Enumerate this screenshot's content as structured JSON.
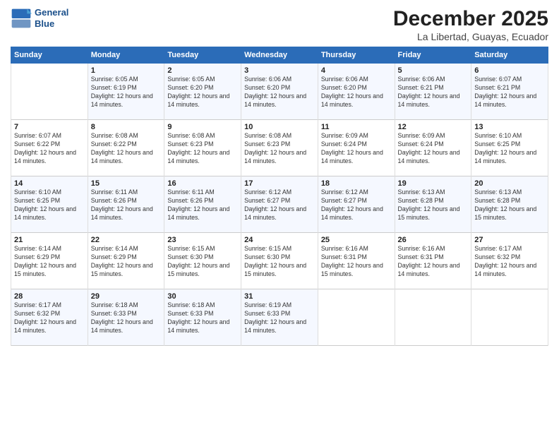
{
  "logo": {
    "line1": "General",
    "line2": "Blue"
  },
  "header": {
    "month": "December 2025",
    "location": "La Libertad, Guayas, Ecuador"
  },
  "days_of_week": [
    "Sunday",
    "Monday",
    "Tuesday",
    "Wednesday",
    "Thursday",
    "Friday",
    "Saturday"
  ],
  "weeks": [
    [
      {
        "day": "",
        "content": ""
      },
      {
        "day": "1",
        "content": "Sunrise: 6:05 AM\nSunset: 6:19 PM\nDaylight: 12 hours and 14 minutes."
      },
      {
        "day": "2",
        "content": "Sunrise: 6:05 AM\nSunset: 6:20 PM\nDaylight: 12 hours and 14 minutes."
      },
      {
        "day": "3",
        "content": "Sunrise: 6:06 AM\nSunset: 6:20 PM\nDaylight: 12 hours and 14 minutes."
      },
      {
        "day": "4",
        "content": "Sunrise: 6:06 AM\nSunset: 6:20 PM\nDaylight: 12 hours and 14 minutes."
      },
      {
        "day": "5",
        "content": "Sunrise: 6:06 AM\nSunset: 6:21 PM\nDaylight: 12 hours and 14 minutes."
      },
      {
        "day": "6",
        "content": "Sunrise: 6:07 AM\nSunset: 6:21 PM\nDaylight: 12 hours and 14 minutes."
      }
    ],
    [
      {
        "day": "7",
        "content": "Sunrise: 6:07 AM\nSunset: 6:22 PM\nDaylight: 12 hours and 14 minutes."
      },
      {
        "day": "8",
        "content": "Sunrise: 6:08 AM\nSunset: 6:22 PM\nDaylight: 12 hours and 14 minutes."
      },
      {
        "day": "9",
        "content": "Sunrise: 6:08 AM\nSunset: 6:23 PM\nDaylight: 12 hours and 14 minutes."
      },
      {
        "day": "10",
        "content": "Sunrise: 6:08 AM\nSunset: 6:23 PM\nDaylight: 12 hours and 14 minutes."
      },
      {
        "day": "11",
        "content": "Sunrise: 6:09 AM\nSunset: 6:24 PM\nDaylight: 12 hours and 14 minutes."
      },
      {
        "day": "12",
        "content": "Sunrise: 6:09 AM\nSunset: 6:24 PM\nDaylight: 12 hours and 14 minutes."
      },
      {
        "day": "13",
        "content": "Sunrise: 6:10 AM\nSunset: 6:25 PM\nDaylight: 12 hours and 14 minutes."
      }
    ],
    [
      {
        "day": "14",
        "content": "Sunrise: 6:10 AM\nSunset: 6:25 PM\nDaylight: 12 hours and 14 minutes."
      },
      {
        "day": "15",
        "content": "Sunrise: 6:11 AM\nSunset: 6:26 PM\nDaylight: 12 hours and 14 minutes."
      },
      {
        "day": "16",
        "content": "Sunrise: 6:11 AM\nSunset: 6:26 PM\nDaylight: 12 hours and 14 minutes."
      },
      {
        "day": "17",
        "content": "Sunrise: 6:12 AM\nSunset: 6:27 PM\nDaylight: 12 hours and 14 minutes."
      },
      {
        "day": "18",
        "content": "Sunrise: 6:12 AM\nSunset: 6:27 PM\nDaylight: 12 hours and 14 minutes."
      },
      {
        "day": "19",
        "content": "Sunrise: 6:13 AM\nSunset: 6:28 PM\nDaylight: 12 hours and 15 minutes."
      },
      {
        "day": "20",
        "content": "Sunrise: 6:13 AM\nSunset: 6:28 PM\nDaylight: 12 hours and 15 minutes."
      }
    ],
    [
      {
        "day": "21",
        "content": "Sunrise: 6:14 AM\nSunset: 6:29 PM\nDaylight: 12 hours and 15 minutes."
      },
      {
        "day": "22",
        "content": "Sunrise: 6:14 AM\nSunset: 6:29 PM\nDaylight: 12 hours and 15 minutes."
      },
      {
        "day": "23",
        "content": "Sunrise: 6:15 AM\nSunset: 6:30 PM\nDaylight: 12 hours and 15 minutes."
      },
      {
        "day": "24",
        "content": "Sunrise: 6:15 AM\nSunset: 6:30 PM\nDaylight: 12 hours and 15 minutes."
      },
      {
        "day": "25",
        "content": "Sunrise: 6:16 AM\nSunset: 6:31 PM\nDaylight: 12 hours and 15 minutes."
      },
      {
        "day": "26",
        "content": "Sunrise: 6:16 AM\nSunset: 6:31 PM\nDaylight: 12 hours and 14 minutes."
      },
      {
        "day": "27",
        "content": "Sunrise: 6:17 AM\nSunset: 6:32 PM\nDaylight: 12 hours and 14 minutes."
      }
    ],
    [
      {
        "day": "28",
        "content": "Sunrise: 6:17 AM\nSunset: 6:32 PM\nDaylight: 12 hours and 14 minutes."
      },
      {
        "day": "29",
        "content": "Sunrise: 6:18 AM\nSunset: 6:33 PM\nDaylight: 12 hours and 14 minutes."
      },
      {
        "day": "30",
        "content": "Sunrise: 6:18 AM\nSunset: 6:33 PM\nDaylight: 12 hours and 14 minutes."
      },
      {
        "day": "31",
        "content": "Sunrise: 6:19 AM\nSunset: 6:33 PM\nDaylight: 12 hours and 14 minutes."
      },
      {
        "day": "",
        "content": ""
      },
      {
        "day": "",
        "content": ""
      },
      {
        "day": "",
        "content": ""
      }
    ]
  ]
}
